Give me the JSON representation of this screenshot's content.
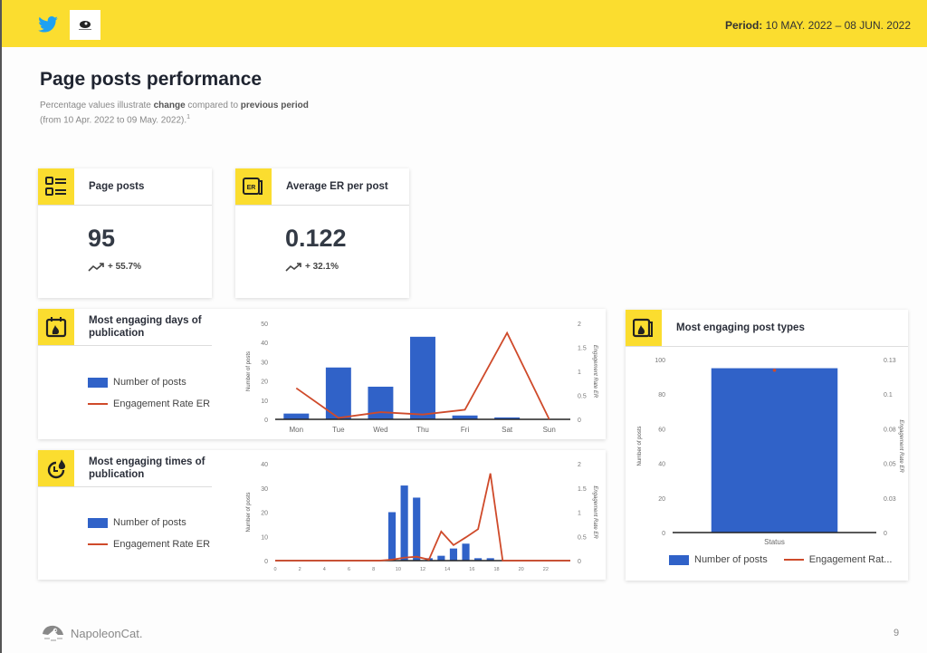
{
  "header": {
    "period_label": "Period:",
    "period_value": "10 MAY. 2022 – 08 JUN. 2022",
    "social_icon": "twitter-icon",
    "brand_icon": "brand-logo"
  },
  "page": {
    "title": "Page posts performance",
    "subtitle_part1": "Percentage values illustrate ",
    "subtitle_bold1": "change",
    "subtitle_part2": " compared to ",
    "subtitle_bold2": "previous period",
    "subtitle_part3": "(from 10 Apr. 2022 to 09 May. 2022).",
    "subtitle_footnote": "1"
  },
  "kpis": [
    {
      "title": "Page posts",
      "value": "95",
      "change": "+ 55.7%",
      "icon": "list-icon",
      "trend_icon": "trend-up-icon"
    },
    {
      "title": "Average ER per post",
      "value": "0.122",
      "change": "+ 32.1%",
      "icon": "er-icon",
      "trend_icon": "trend-up-icon"
    }
  ],
  "legend": {
    "bars": "Number of posts",
    "line": "Engagement Rate ER",
    "line_truncated": "Engagement Rat..."
  },
  "colors": {
    "accent": "#fbdd2f",
    "bar": "#3062c8",
    "line": "#cf4a2a"
  },
  "cards": {
    "days_title": "Most engaging days of publication",
    "times_title": "Most engaging times of publication",
    "types_title": "Most engaging post types"
  },
  "chart_data": [
    {
      "id": "days",
      "type": "bar",
      "title": "Most engaging days of publication",
      "categories": [
        "Mon",
        "Tue",
        "Wed",
        "Thu",
        "Fri",
        "Sat",
        "Sun"
      ],
      "series": [
        {
          "name": "Number of posts",
          "kind": "bar",
          "axis": "left",
          "values": [
            3,
            27,
            17,
            43,
            2,
            1,
            0
          ]
        },
        {
          "name": "Engagement Rate ER",
          "kind": "line",
          "axis": "right",
          "values": [
            0.65,
            0.03,
            0.15,
            0.1,
            0.2,
            1.8,
            0
          ]
        }
      ],
      "ylabel": "Number of posts",
      "y2label": "Engagement Rate ER",
      "ylim": [
        0,
        50
      ],
      "yticks": [
        0,
        10,
        20,
        30,
        40,
        50
      ],
      "y2lim": [
        0,
        2
      ],
      "y2ticks": [
        "0",
        "0.5",
        "1",
        "1.5",
        "2"
      ],
      "legend": "left"
    },
    {
      "id": "times",
      "type": "bar",
      "title": "Most engaging times of publication",
      "categories": [
        0,
        1,
        2,
        3,
        4,
        5,
        6,
        7,
        8,
        9,
        10,
        11,
        12,
        13,
        14,
        15,
        16,
        17,
        18,
        19,
        20,
        21,
        22,
        23
      ],
      "xticks": [
        "0",
        "2",
        "4",
        "6",
        "8",
        "10",
        "12",
        "14",
        "16",
        "18",
        "20",
        "22"
      ],
      "series": [
        {
          "name": "Number of posts",
          "kind": "bar",
          "axis": "left",
          "values": [
            0,
            0,
            0,
            0,
            0,
            0,
            0,
            0,
            0,
            20,
            31,
            26,
            1,
            2,
            5,
            7,
            1,
            1,
            0,
            0,
            0,
            0,
            0,
            0
          ]
        },
        {
          "name": "Engagement Rate ER",
          "kind": "line",
          "axis": "right",
          "values": [
            0,
            0,
            0,
            0,
            0,
            0,
            0,
            0,
            0,
            0.02,
            0.06,
            0.08,
            0.02,
            0.6,
            0.32,
            0.48,
            0.65,
            1.8,
            0,
            0,
            0,
            0,
            0,
            0
          ]
        }
      ],
      "ylabel": "Number of posts",
      "y2label": "Engagement Rate ER",
      "ylim": [
        0,
        40
      ],
      "yticks": [
        0,
        10,
        20,
        30,
        40
      ],
      "y2lim": [
        0,
        2
      ],
      "y2ticks": [
        "0",
        "0.5",
        "1",
        "1.5",
        "2"
      ],
      "legend": "left"
    },
    {
      "id": "types",
      "type": "bar",
      "title": "Most engaging post types",
      "categories": [
        "Status"
      ],
      "series": [
        {
          "name": "Number of posts",
          "kind": "bar",
          "axis": "left",
          "values": [
            95
          ]
        },
        {
          "name": "Engagement Rate ER",
          "kind": "point",
          "axis": "right",
          "values": [
            0.122
          ]
        }
      ],
      "ylabel": "Number of posts",
      "y2label": "Engagement Rate ER",
      "ylim": [
        0,
        100
      ],
      "yticks": [
        0,
        20,
        40,
        60,
        80,
        100
      ],
      "y2lim": [
        0,
        0.13
      ],
      "y2ticks": [
        "0",
        "0.03",
        "0.05",
        "0.08",
        "0.1",
        "0.13"
      ],
      "legend": "bottom"
    }
  ],
  "footer": {
    "brand": "NapoleonCat.",
    "page_number": "9"
  }
}
